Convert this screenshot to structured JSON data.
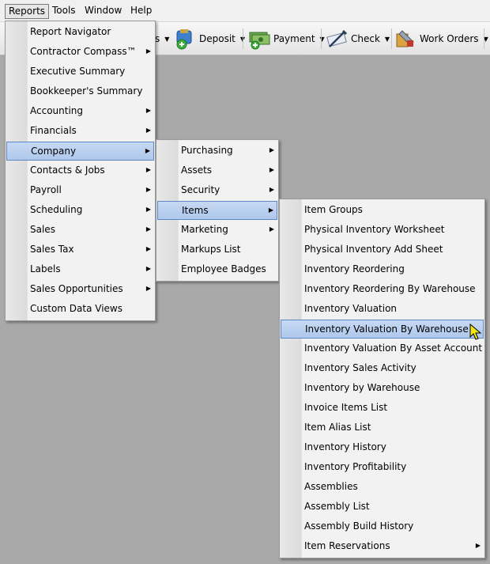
{
  "menubar": {
    "items": [
      {
        "label": "Reports",
        "active": true
      },
      {
        "label": "Tools"
      },
      {
        "label": "Window"
      },
      {
        "label": "Help"
      }
    ]
  },
  "toolbar": {
    "partial_label": "s",
    "buttons": [
      {
        "label": "Deposit",
        "icon": "deposit-icon"
      },
      {
        "label": "Payment",
        "icon": "payment-icon"
      },
      {
        "label": "Check",
        "icon": "check-icon"
      },
      {
        "label": "Work Orders",
        "icon": "work-orders-icon"
      }
    ]
  },
  "reports_menu": {
    "items": [
      {
        "label": "Report Navigator",
        "submenu": false
      },
      {
        "label": "Contractor Compass™",
        "submenu": true
      },
      {
        "label": "Executive Summary",
        "submenu": false
      },
      {
        "label": "Bookkeeper's Summary",
        "submenu": false
      },
      {
        "label": "Accounting",
        "submenu": true
      },
      {
        "label": "Financials",
        "submenu": true
      },
      {
        "label": "Company",
        "submenu": true,
        "highlighted": true
      },
      {
        "label": "Contacts & Jobs",
        "submenu": true
      },
      {
        "label": "Payroll",
        "submenu": true
      },
      {
        "label": "Scheduling",
        "submenu": true
      },
      {
        "label": "Sales",
        "submenu": true
      },
      {
        "label": "Sales Tax",
        "submenu": true
      },
      {
        "label": "Labels",
        "submenu": true
      },
      {
        "label": "Sales Opportunities",
        "submenu": true
      },
      {
        "label": "Custom Data Views",
        "submenu": false
      }
    ]
  },
  "company_menu": {
    "items": [
      {
        "label": "Purchasing",
        "submenu": true
      },
      {
        "label": "Assets",
        "submenu": true
      },
      {
        "label": "Security",
        "submenu": true
      },
      {
        "label": "Items",
        "submenu": true,
        "highlighted": true
      },
      {
        "label": "Marketing",
        "submenu": true
      },
      {
        "label": "Markups List",
        "submenu": false
      },
      {
        "label": "Employee Badges",
        "submenu": false
      }
    ]
  },
  "items_menu": {
    "items": [
      {
        "label": "Item Groups",
        "submenu": false
      },
      {
        "label": "Physical Inventory Worksheet",
        "submenu": false
      },
      {
        "label": "Physical Inventory Add Sheet",
        "submenu": false
      },
      {
        "label": "Inventory Reordering",
        "submenu": false
      },
      {
        "label": "Inventory Reordering By Warehouse",
        "submenu": false
      },
      {
        "label": "Inventory Valuation",
        "submenu": false
      },
      {
        "label": "Inventory Valuation By Warehouse",
        "submenu": false,
        "highlighted": true
      },
      {
        "label": "Inventory Valuation By Asset Account",
        "submenu": false
      },
      {
        "label": "Inventory Sales Activity",
        "submenu": false
      },
      {
        "label": "Inventory by Warehouse",
        "submenu": false
      },
      {
        "label": "Invoice Items List",
        "submenu": false
      },
      {
        "label": "Item Alias List",
        "submenu": false
      },
      {
        "label": "Inventory History",
        "submenu": false
      },
      {
        "label": "Inventory Profitability",
        "submenu": false
      },
      {
        "label": "Assemblies",
        "submenu": false
      },
      {
        "label": "Assembly List",
        "submenu": false
      },
      {
        "label": "Assembly Build History",
        "submenu": false
      },
      {
        "label": "Item Reservations",
        "submenu": true
      }
    ]
  },
  "colors": {
    "highlight_fill": "#b9d0f0",
    "highlight_border": "#5f87c6",
    "desktop": "#a9a9a9"
  }
}
